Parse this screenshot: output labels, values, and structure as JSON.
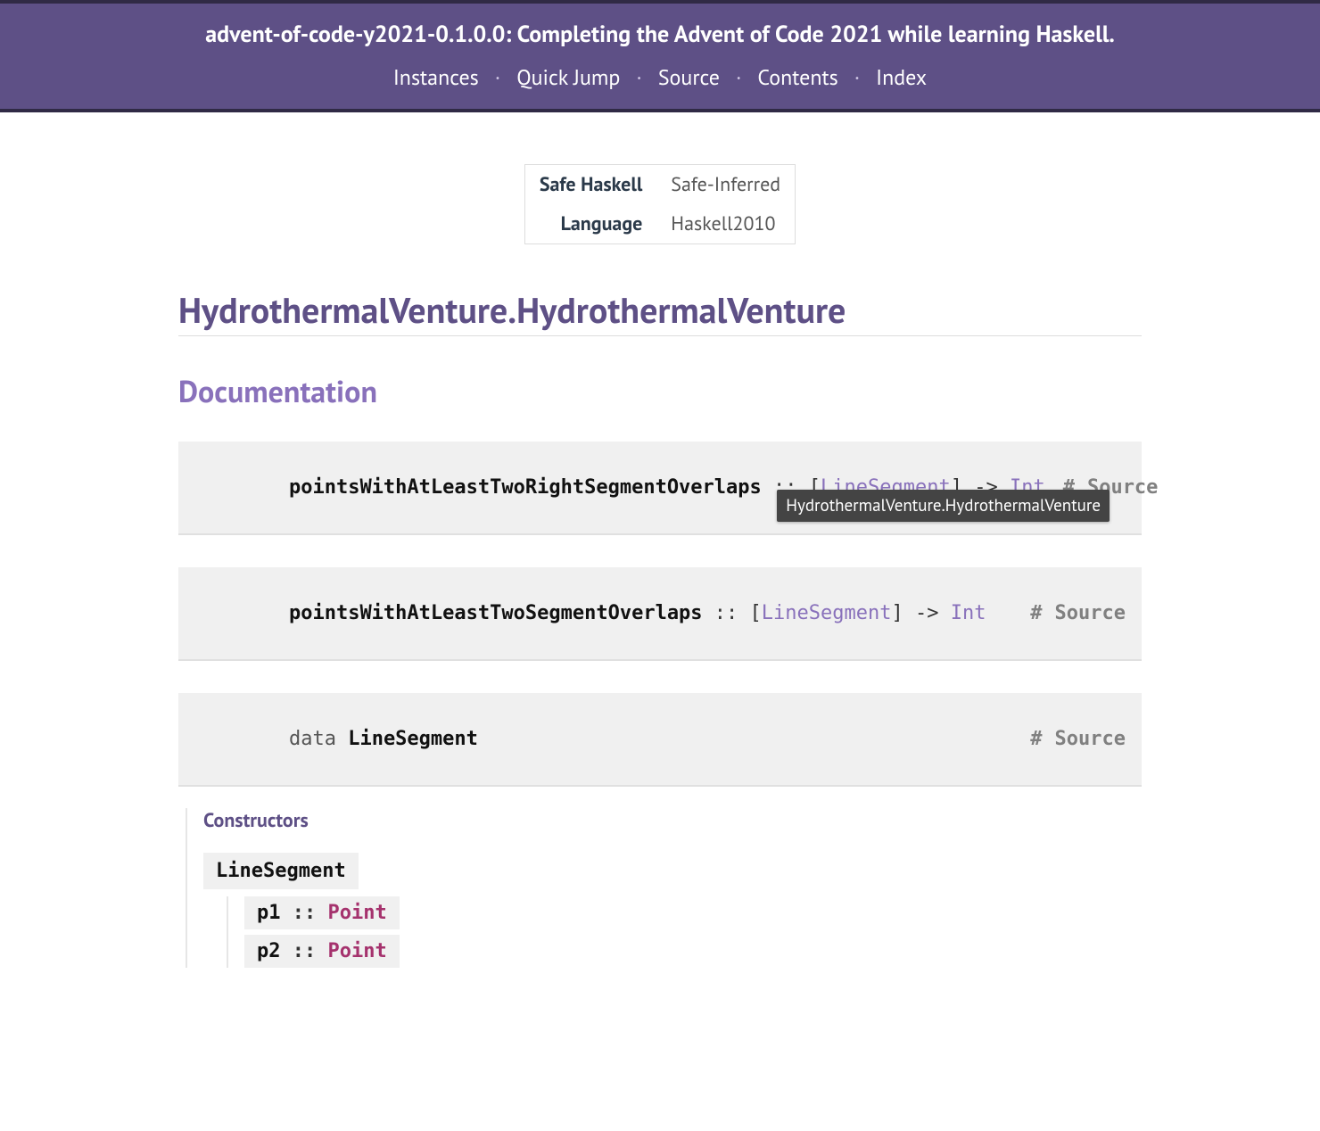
{
  "header": {
    "caption": "advent-of-code-y2021-0.1.0.0: Completing the Advent of Code 2021 while learning Haskell.",
    "links": {
      "instances": "Instances",
      "quickjump": "Quick Jump",
      "source": "Source",
      "contents": "Contents",
      "index": "Index"
    }
  },
  "info": {
    "safe_haskell_label": "Safe Haskell",
    "safe_haskell_value": "Safe-Inferred",
    "language_label": "Language",
    "language_value": "Haskell2010"
  },
  "module_title": "HydrothermalVenture.HydrothermalVenture",
  "section_heading": "Documentation",
  "sig1": {
    "name": "pointsWithAtLeastTwoRightSegmentOverlaps",
    "dcolon": " :: [",
    "type_link": "LineSegment",
    "after_link": "] -> ",
    "ret": "Int"
  },
  "sig2": {
    "name": "pointsWithAtLeastTwoSegmentOverlaps",
    "dcolon": " :: [",
    "type_link": "LineSegment",
    "after_link": "] -> ",
    "ret": "Int"
  },
  "data_decl": {
    "kw": "data ",
    "name": "LineSegment"
  },
  "right_links": {
    "hash": "#",
    "source": "Source"
  },
  "tooltip": "HydrothermalVenture.HydrothermalVenture",
  "constructors": {
    "caption": "Constructors",
    "ctor": "LineSegment",
    "fields": [
      {
        "name": "p1",
        "dcolon": " :: ",
        "type": "Point"
      },
      {
        "name": "p2",
        "dcolon": " :: ",
        "type": "Point"
      }
    ]
  }
}
